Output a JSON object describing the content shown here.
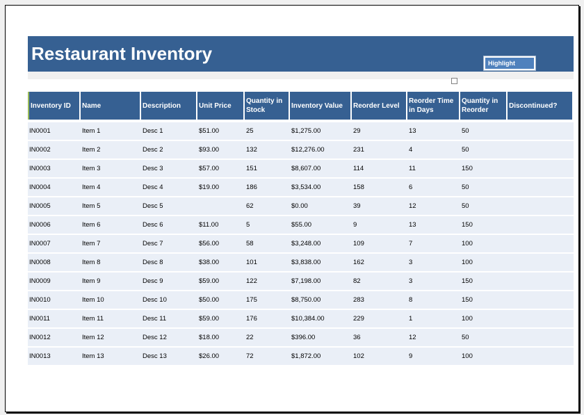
{
  "title": "Restaurant Inventory",
  "highlight_button": "Highlight",
  "colors": {
    "header_bg": "#366092",
    "row_bg": "#eaeff7",
    "button_bg": "#4f81bd"
  },
  "columns": [
    "Inventory ID",
    "Name",
    "Description",
    "Unit Price",
    "Quantity in Stock",
    "Inventory Value",
    "Reorder Level",
    "Reorder Time in Days",
    "Quantity in Reorder",
    "Discontinued?"
  ],
  "rows": [
    [
      "IN0001",
      "Item 1",
      "Desc 1",
      "$51.00",
      "25",
      "$1,275.00",
      "29",
      "13",
      "50",
      ""
    ],
    [
      "IN0002",
      "Item 2",
      "Desc 2",
      "$93.00",
      "132",
      "$12,276.00",
      "231",
      "4",
      "50",
      ""
    ],
    [
      "IN0003",
      "Item 3",
      "Desc 3",
      "$57.00",
      "151",
      "$8,607.00",
      "114",
      "11",
      "150",
      ""
    ],
    [
      "IN0004",
      "Item 4",
      "Desc 4",
      "$19.00",
      "186",
      "$3,534.00",
      "158",
      "6",
      "50",
      ""
    ],
    [
      "IN0005",
      "Item 5",
      "Desc 5",
      "",
      "62",
      "$0.00",
      "39",
      "12",
      "50",
      ""
    ],
    [
      "IN0006",
      "Item 6",
      "Desc 6",
      "$11.00",
      "5",
      "$55.00",
      "9",
      "13",
      "150",
      ""
    ],
    [
      "IN0007",
      "Item 7",
      "Desc 7",
      "$56.00",
      "58",
      "$3,248.00",
      "109",
      "7",
      "100",
      ""
    ],
    [
      "IN0008",
      "Item 8",
      "Desc 8",
      "$38.00",
      "101",
      "$3,838.00",
      "162",
      "3",
      "100",
      ""
    ],
    [
      "IN0009",
      "Item 9",
      "Desc 9",
      "$59.00",
      "122",
      "$7,198.00",
      "82",
      "3",
      "150",
      ""
    ],
    [
      "IN0010",
      "Item 10",
      "Desc 10",
      "$50.00",
      "175",
      "$8,750.00",
      "283",
      "8",
      "150",
      ""
    ],
    [
      "IN0011",
      "Item 11",
      "Desc 11",
      "$59.00",
      "176",
      "$10,384.00",
      "229",
      "1",
      "100",
      ""
    ],
    [
      "IN0012",
      "Item 12",
      "Desc 12",
      "$18.00",
      "22",
      "$396.00",
      "36",
      "12",
      "50",
      ""
    ],
    [
      "IN0013",
      "Item 13",
      "Desc 13",
      "$26.00",
      "72",
      "$1,872.00",
      "102",
      "9",
      "100",
      ""
    ]
  ]
}
